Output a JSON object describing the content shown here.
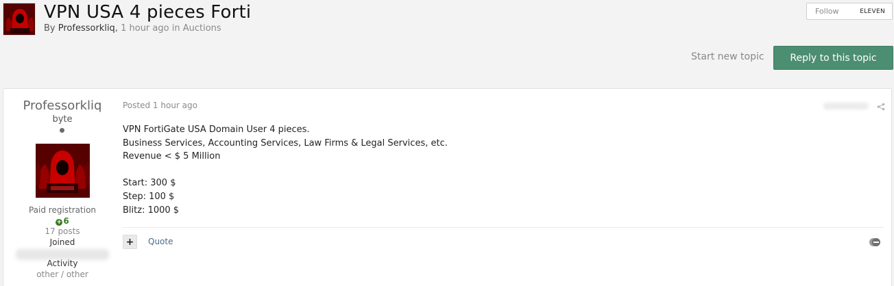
{
  "topic": {
    "title": "VPN USA 4 pieces Forti",
    "by_prefix": "By",
    "author": "Professorkliq",
    "separator": ",",
    "time": "1 hour ago",
    "in_word": "in",
    "forum": "Auctions"
  },
  "follow": {
    "label": "Follow",
    "count": "ELEVEN"
  },
  "actions": {
    "start_new_topic": "Start new topic",
    "reply": "Reply to this topic"
  },
  "author_panel": {
    "name": "Professorkliq",
    "rank": "byte",
    "group": "Paid registration",
    "reputation": "6",
    "posts": "17 posts",
    "joined_label": "Joined",
    "activity_label": "Activity",
    "activity_value": "other / other"
  },
  "post": {
    "posted": "Posted 1 hour ago",
    "lines": [
      "VPN FortiGate USA Domain User 4 pieces.",
      "Business Services, Accounting Services, Law Firms & Legal Services, etc.",
      "Revenue < $ 5 Million",
      "",
      "Start: 300 $",
      "Step: 100 $",
      "Blitz: 1000 $"
    ],
    "multiquote_symbol": "+",
    "quote_label": "Quote"
  },
  "icons": {
    "share": "share-icon",
    "reaction": "reaction-icon",
    "online": "online-status-icon",
    "reputation": "plus-circle-icon"
  },
  "colors": {
    "reply_button": "#4c8e72",
    "reputation": "#3a7a25",
    "link": "#4a6a8a"
  }
}
